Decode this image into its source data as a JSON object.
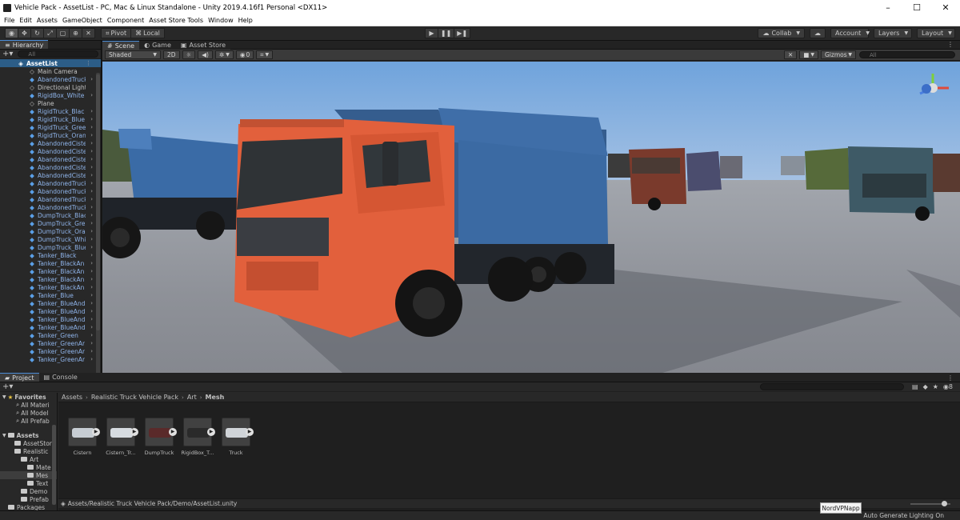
{
  "window": {
    "title": "Vehicle Pack - AssetList - PC, Mac & Linux Standalone - Unity 2019.4.16f1 Personal <DX11>"
  },
  "window_controls": {
    "minimize": "–",
    "maximize": "☐",
    "close": "✕"
  },
  "menu": [
    "File",
    "Edit",
    "Assets",
    "GameObject",
    "Component",
    "Asset Store Tools",
    "Window",
    "Help"
  ],
  "toolbar": {
    "pivot_label": "Pivot",
    "local_label": "Local",
    "collab_label": "Collab",
    "account_label": "Account",
    "layers_label": "Layers",
    "layout_label": "Layout"
  },
  "hierarchy": {
    "tab_label": "Hierarchy",
    "search_placeholder": "All",
    "scene_name": "AssetList",
    "items": [
      {
        "label": "Main Camera",
        "prefab": false
      },
      {
        "label": "AbandonedTruck",
        "prefab": true
      },
      {
        "label": "Directional Light",
        "prefab": false
      },
      {
        "label": "RigidBox_White",
        "prefab": true
      },
      {
        "label": "Plane",
        "prefab": false
      },
      {
        "label": "RigidTruck_Blac",
        "prefab": true
      },
      {
        "label": "RigidTruck_Blue",
        "prefab": true
      },
      {
        "label": "RigidTruck_Gree",
        "prefab": true
      },
      {
        "label": "RigidTruck_Oran",
        "prefab": true
      },
      {
        "label": "AbandonedCiste",
        "prefab": true
      },
      {
        "label": "AbandonedCiste",
        "prefab": true
      },
      {
        "label": "AbandonedCiste",
        "prefab": true
      },
      {
        "label": "AbandonedCiste",
        "prefab": true
      },
      {
        "label": "AbandonedCiste",
        "prefab": true
      },
      {
        "label": "AbandonedTruck",
        "prefab": true
      },
      {
        "label": "AbandonedTruck",
        "prefab": true
      },
      {
        "label": "AbandonedTruck",
        "prefab": true
      },
      {
        "label": "AbandonedTruck",
        "prefab": true
      },
      {
        "label": "DumpTruck_Blac",
        "prefab": true
      },
      {
        "label": "DumpTruck_Gre",
        "prefab": true
      },
      {
        "label": "DumpTruck_Ora",
        "prefab": true
      },
      {
        "label": "DumpTruck_Whi",
        "prefab": true
      },
      {
        "label": "DumpTruck_Blue",
        "prefab": true
      },
      {
        "label": "Tanker_Black",
        "prefab": true
      },
      {
        "label": "Tanker_BlackAn",
        "prefab": true
      },
      {
        "label": "Tanker_BlackAn",
        "prefab": true
      },
      {
        "label": "Tanker_BlackAn",
        "prefab": true
      },
      {
        "label": "Tanker_BlackAn",
        "prefab": true
      },
      {
        "label": "Tanker_Blue",
        "prefab": true
      },
      {
        "label": "Tanker_BlueAnd",
        "prefab": true
      },
      {
        "label": "Tanker_BlueAnd",
        "prefab": true
      },
      {
        "label": "Tanker_BlueAnd",
        "prefab": true
      },
      {
        "label": "Tanker_BlueAnd",
        "prefab": true
      },
      {
        "label": "Tanker_Green",
        "prefab": true
      },
      {
        "label": "Tanker_GreenAr",
        "prefab": true
      },
      {
        "label": "Tanker_GreenAr",
        "prefab": true
      },
      {
        "label": "Tanker_GreenAr",
        "prefab": true
      },
      {
        "label": "Tanker_GreenAr",
        "prefab": true
      }
    ]
  },
  "scene_view": {
    "tabs": [
      "Scene",
      "Game",
      "Asset Store"
    ],
    "shading_mode": "Shaded",
    "mode_2d": "2D",
    "fx_count": "0",
    "gizmos_label": "Gizmos",
    "search_placeholder": "All"
  },
  "bottom_tabs": [
    "Project",
    "Console"
  ],
  "project": {
    "favorites_label": "Favorites",
    "favorites": [
      "All Materi",
      "All Model",
      "All Prefab"
    ],
    "assets_label": "Assets",
    "tree": [
      {
        "label": "AssetStor",
        "level": 1
      },
      {
        "label": "Realistic",
        "level": 1
      },
      {
        "label": "Art",
        "level": 2
      },
      {
        "label": "Mate",
        "level": 3
      },
      {
        "label": "Mes",
        "level": 3,
        "selected": true
      },
      {
        "label": "Text",
        "level": 3
      },
      {
        "label": "Demo",
        "level": 2
      },
      {
        "label": "Prefab",
        "level": 2
      },
      {
        "label": "Packages",
        "level": 0
      }
    ],
    "breadcrumbs": [
      "Assets",
      "Realistic Truck Vehicle Pack",
      "Art",
      "Mesh"
    ],
    "assets": [
      "Cistern",
      "Cistern_Tr...",
      "DumpTruck",
      "RigidBox_T...",
      "Truck"
    ],
    "hidden_count": "8",
    "path": "Assets/Realistic Truck Vehicle Pack/Demo/AssetList.unity"
  },
  "status": {
    "auto_generate": "Auto Generate Lighting On",
    "tooltip": "NordVPNapp"
  },
  "colors": {
    "accent": "#4a8bd6",
    "prefab_text": "#8fb4ea",
    "truck_cab": "#e8603c",
    "truck_bed": "#3d6ea8"
  }
}
